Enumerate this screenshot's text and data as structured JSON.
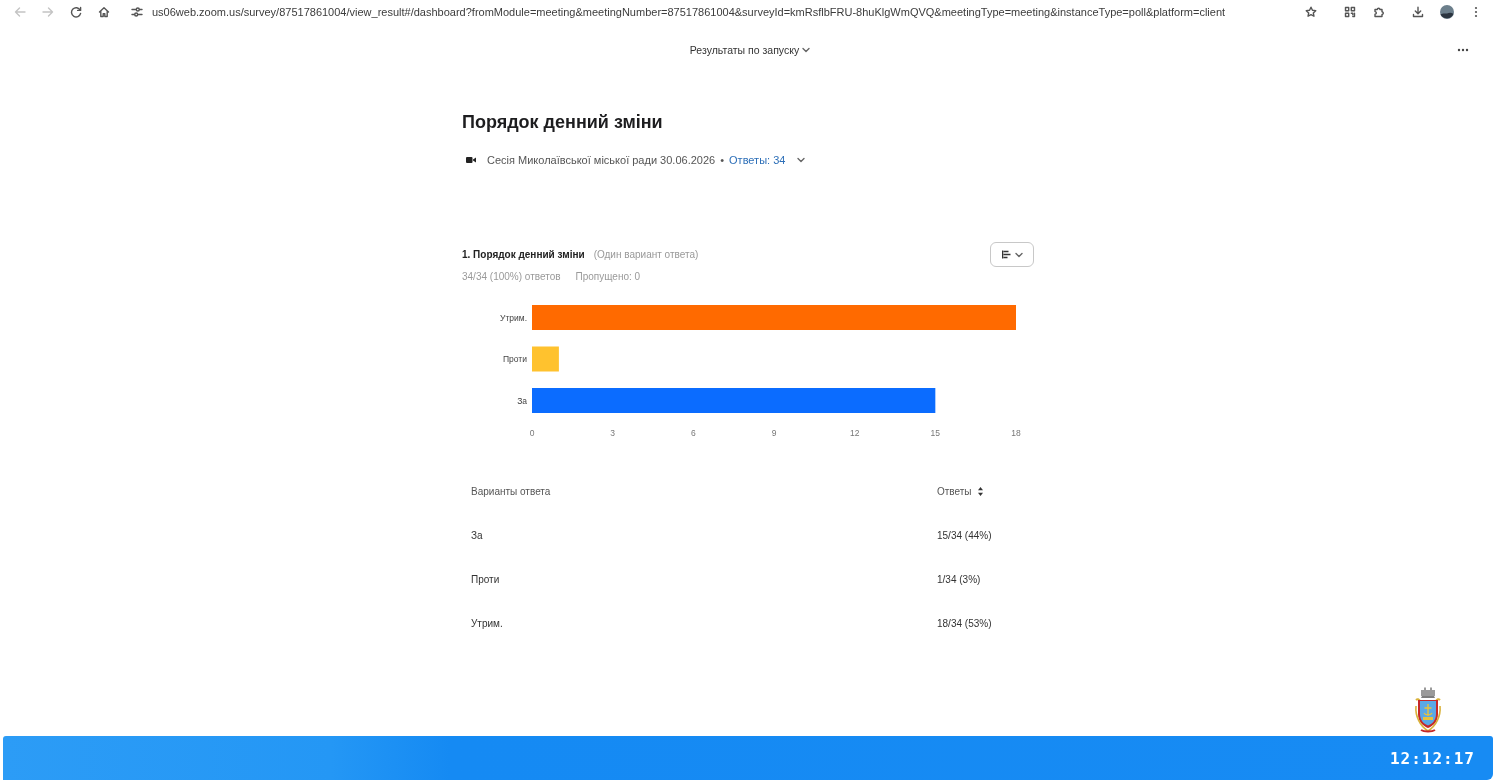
{
  "browser": {
    "back": {
      "disabled": true
    },
    "forward": {
      "disabled": true
    },
    "url": "us06web.zoom.us/survey/87517861004/view_result#/dashboard?fromModule=meeting&meetingNumber=87517861004&surveyId=kmRsflbFRU-8huKlgWmQVQ&meetingType=meeting&instanceType=poll&platform=client"
  },
  "header": {
    "launch_selector": "Результаты по запуску"
  },
  "title": "Порядок денний зміни",
  "meeting": {
    "name": "Сесія Миколаївської міської ради 30.06.2026",
    "separator": "•",
    "responses_link": "Ответы: 34"
  },
  "question": {
    "title": "1. Порядок денний зміни",
    "answer_type": "(Один вариант ответа)",
    "answered": "34/34 (100%) ответов",
    "skipped": "Пропущено: 0",
    "chart_data": {
      "type": "bar",
      "orientation": "horizontal",
      "categories": [
        "Утрим.",
        "Проти",
        "За"
      ],
      "values": [
        18,
        1,
        15
      ],
      "colors": [
        "#ff6a00",
        "#ffc22e",
        "#0b6cff"
      ],
      "xlim": [
        0,
        18
      ],
      "xticks": [
        0,
        3,
        6,
        9,
        12,
        15,
        18
      ]
    }
  },
  "table": {
    "columns": [
      "Варианты ответа",
      "Ответы"
    ],
    "rows": [
      {
        "option": "За",
        "responses": "15/34 (44%)"
      },
      {
        "option": "Проти",
        "responses": "1/34 (3%)"
      },
      {
        "option": "Утрим.",
        "responses": "18/34 (53%)"
      }
    ]
  },
  "broadcast": {
    "clock": "12:12:17"
  }
}
